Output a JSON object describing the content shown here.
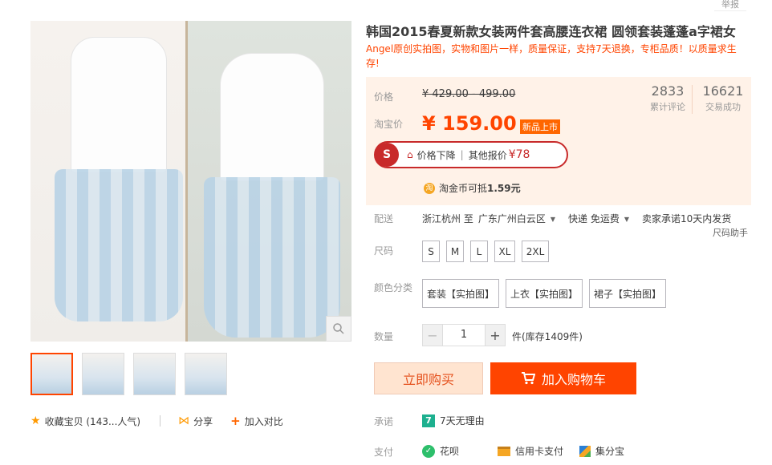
{
  "report_link": "举报",
  "title": "韩国2015春夏新款女装两件套高腰连衣裙 圆领套装蓬蓬a字裙女",
  "subtitle": "Angel原创实拍图，实物和图片一样，质量保证，支持7天退换，专柜品质！以质量求生存!",
  "price": {
    "label": "价格",
    "original": "¥ 429.00 - 499.00",
    "promo_label": "淘宝价",
    "promo": "¥ 159.00",
    "badge": "新品上市"
  },
  "stats": [
    {
      "num": "2833",
      "label": "累计评论"
    },
    {
      "num": "16621",
      "label": "交易成功"
    }
  ],
  "price_drop": {
    "logo": "S",
    "text": "价格下降",
    "sep": "|",
    "other": "其他报价",
    "other_price": "¥78"
  },
  "coin": {
    "icon": "淘",
    "text": "淘金币可抵",
    "amount": "1.59元"
  },
  "shipping": {
    "label": "配送",
    "from": "浙江杭州 至",
    "to": "广东广州白云区",
    "method": "快递 免运费",
    "promise": "卖家承诺10天内发货"
  },
  "size_helper": "尺码助手",
  "size": {
    "label": "尺码",
    "options": [
      "S",
      "M",
      "L",
      "XL",
      "2XL"
    ]
  },
  "color": {
    "label": "颜色分类",
    "options": [
      "套装【实拍图】",
      "上衣【实拍图】",
      "裙子【实拍图】"
    ]
  },
  "quantity": {
    "label": "数量",
    "value": "1",
    "minus": "−",
    "plus": "+",
    "stock": "件(库存1409件)"
  },
  "buttons": {
    "buy_now": "立即购买",
    "add_cart": "加入购物车"
  },
  "promise": {
    "label": "承诺",
    "icon": "7",
    "text": "7天无理由"
  },
  "payment": {
    "label": "支付",
    "items": [
      {
        "icon": "huabei-icon",
        "name": "花呗"
      },
      {
        "icon": "credit-card-icon",
        "name": "信用卡支付"
      },
      {
        "icon": "jifen-icon",
        "name": "集分宝"
      }
    ]
  },
  "actions": {
    "favorite": "收藏宝贝 (143...人气)",
    "share": "分享",
    "compare": "加入对比"
  },
  "colors": {
    "accent": "#ff4400",
    "price": "#ff4400",
    "price_bg": "#fff2e8",
    "drop_red": "#c82a2a"
  }
}
